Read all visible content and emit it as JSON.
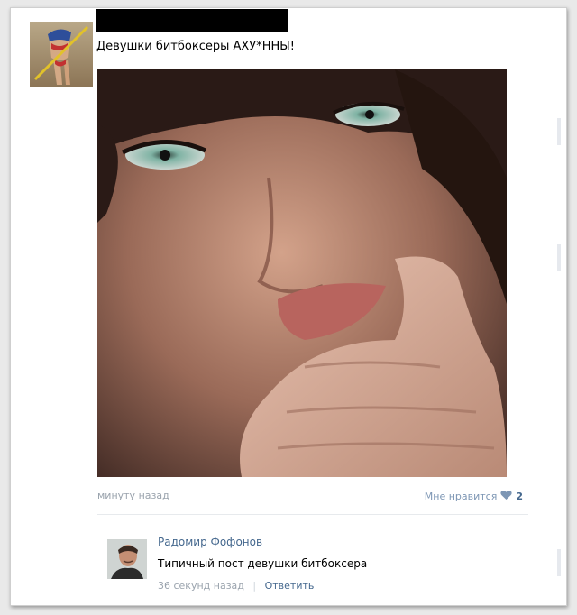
{
  "post": {
    "text": "Девушки битбоксеры АХУ*ННЫ!",
    "time": "минуту назад",
    "like_label": "Мне нравится",
    "like_count": "2"
  },
  "comment": {
    "author": "Радомир Фофонов",
    "text": "Типичный пост девушки битбоксера",
    "time": "36 секунд назад",
    "reply_label": "Ответить"
  },
  "icons": {
    "like": "heart-icon"
  },
  "colors": {
    "link": "#45688e",
    "muted": "#9aa3ad",
    "like_heart": "#7d96b4"
  }
}
